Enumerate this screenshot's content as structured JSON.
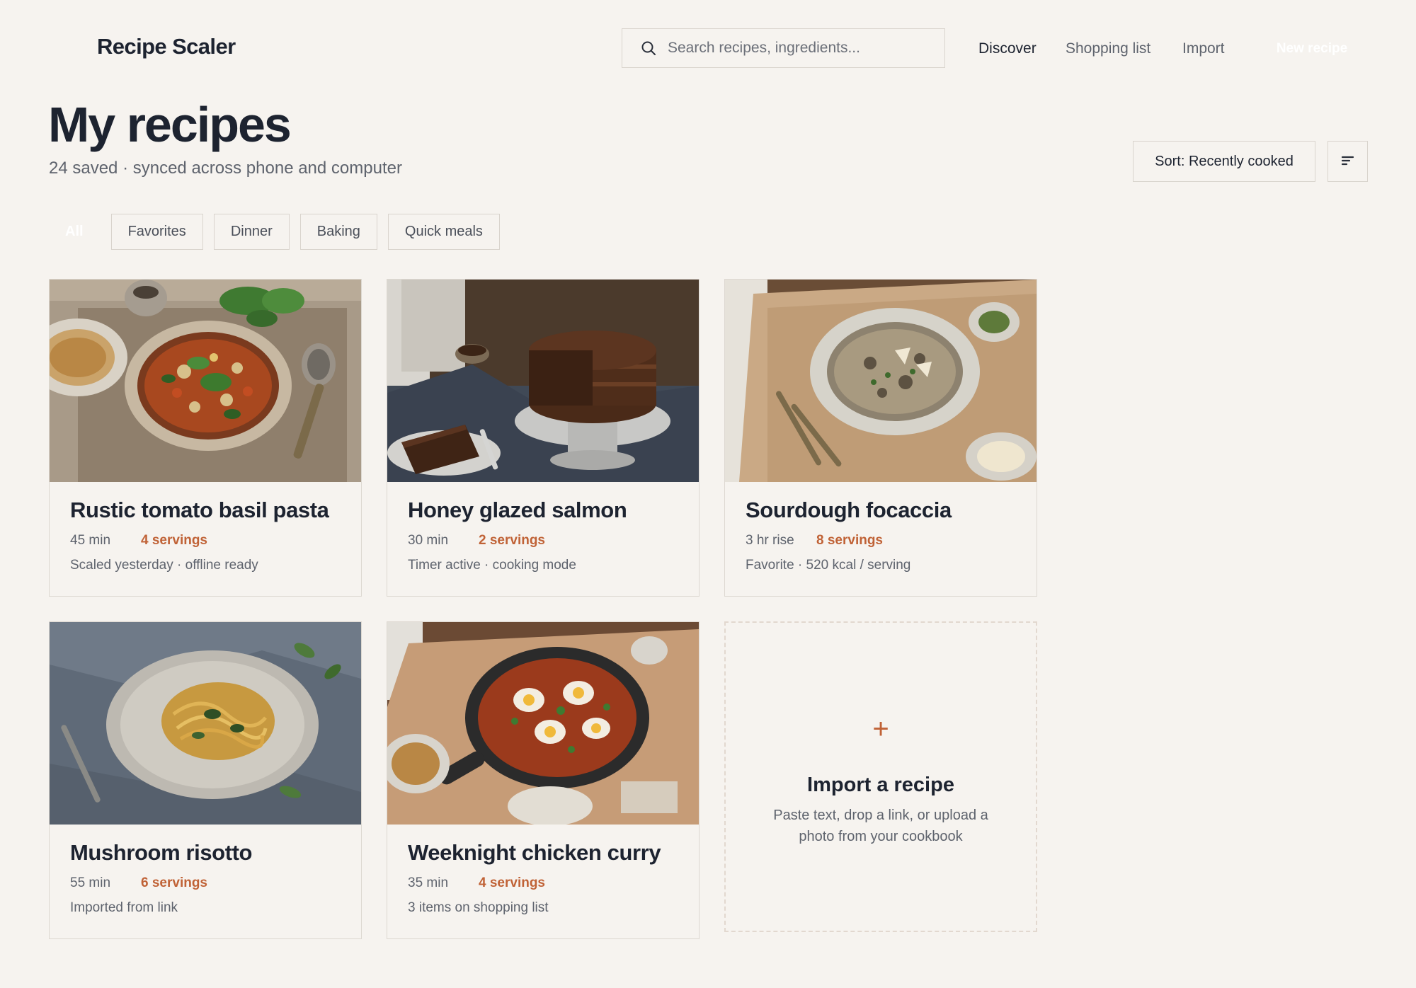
{
  "header": {
    "brand": "Recipe Scaler",
    "search_placeholder": "Search recipes, ingredients...",
    "nav": [
      {
        "label": "Discover",
        "active": true
      },
      {
        "label": "Shopping list",
        "active": false
      },
      {
        "label": "Import",
        "active": false
      }
    ],
    "new_recipe_label": "New recipe"
  },
  "page": {
    "title": "My recipes",
    "subtitle": "24 saved · synced across phone and computer",
    "sort_label": "Sort: Recently cooked",
    "filter_icon": "filter-lines-icon"
  },
  "chips": [
    {
      "label": "All",
      "selected": true
    },
    {
      "label": "Favorites",
      "selected": false
    },
    {
      "label": "Dinner",
      "selected": false
    },
    {
      "label": "Baking",
      "selected": false
    },
    {
      "label": "Quick meals",
      "selected": false
    }
  ],
  "recipes": [
    {
      "title": "Rustic tomato basil pasta",
      "time": "45 min",
      "servings": "4 servings",
      "note": "Scaled yesterday · offline ready",
      "photo": "stew-bowl-photo"
    },
    {
      "title": "Honey glazed salmon",
      "time": "30 min",
      "servings": "2 servings",
      "note": "Timer active · cooking mode",
      "photo": "chocolate-cake-photo"
    },
    {
      "title": "Sourdough focaccia",
      "time": "3 hr rise",
      "servings": "8 servings",
      "note": "Favorite · 520 kcal / serving",
      "photo": "risotto-bowl-photo"
    },
    {
      "title": "Mushroom risotto",
      "time": "55 min",
      "servings": "6 servings",
      "note": "Imported from link",
      "photo": "pasta-plate-photo"
    },
    {
      "title": "Weeknight chicken curry",
      "time": "35 min",
      "servings": "4 servings",
      "note": "3 items on shopping list",
      "photo": "shakshuka-pan-photo"
    }
  ],
  "import_card": {
    "plus": "+",
    "title": "Import a recipe",
    "description": "Paste text, drop a link, or upload a photo from your cookbook"
  },
  "colors": {
    "background": "#f6f3ef",
    "text": "#1d2330",
    "muted": "#5e636d",
    "accent": "#c06236",
    "border": "#d9d4cd"
  }
}
